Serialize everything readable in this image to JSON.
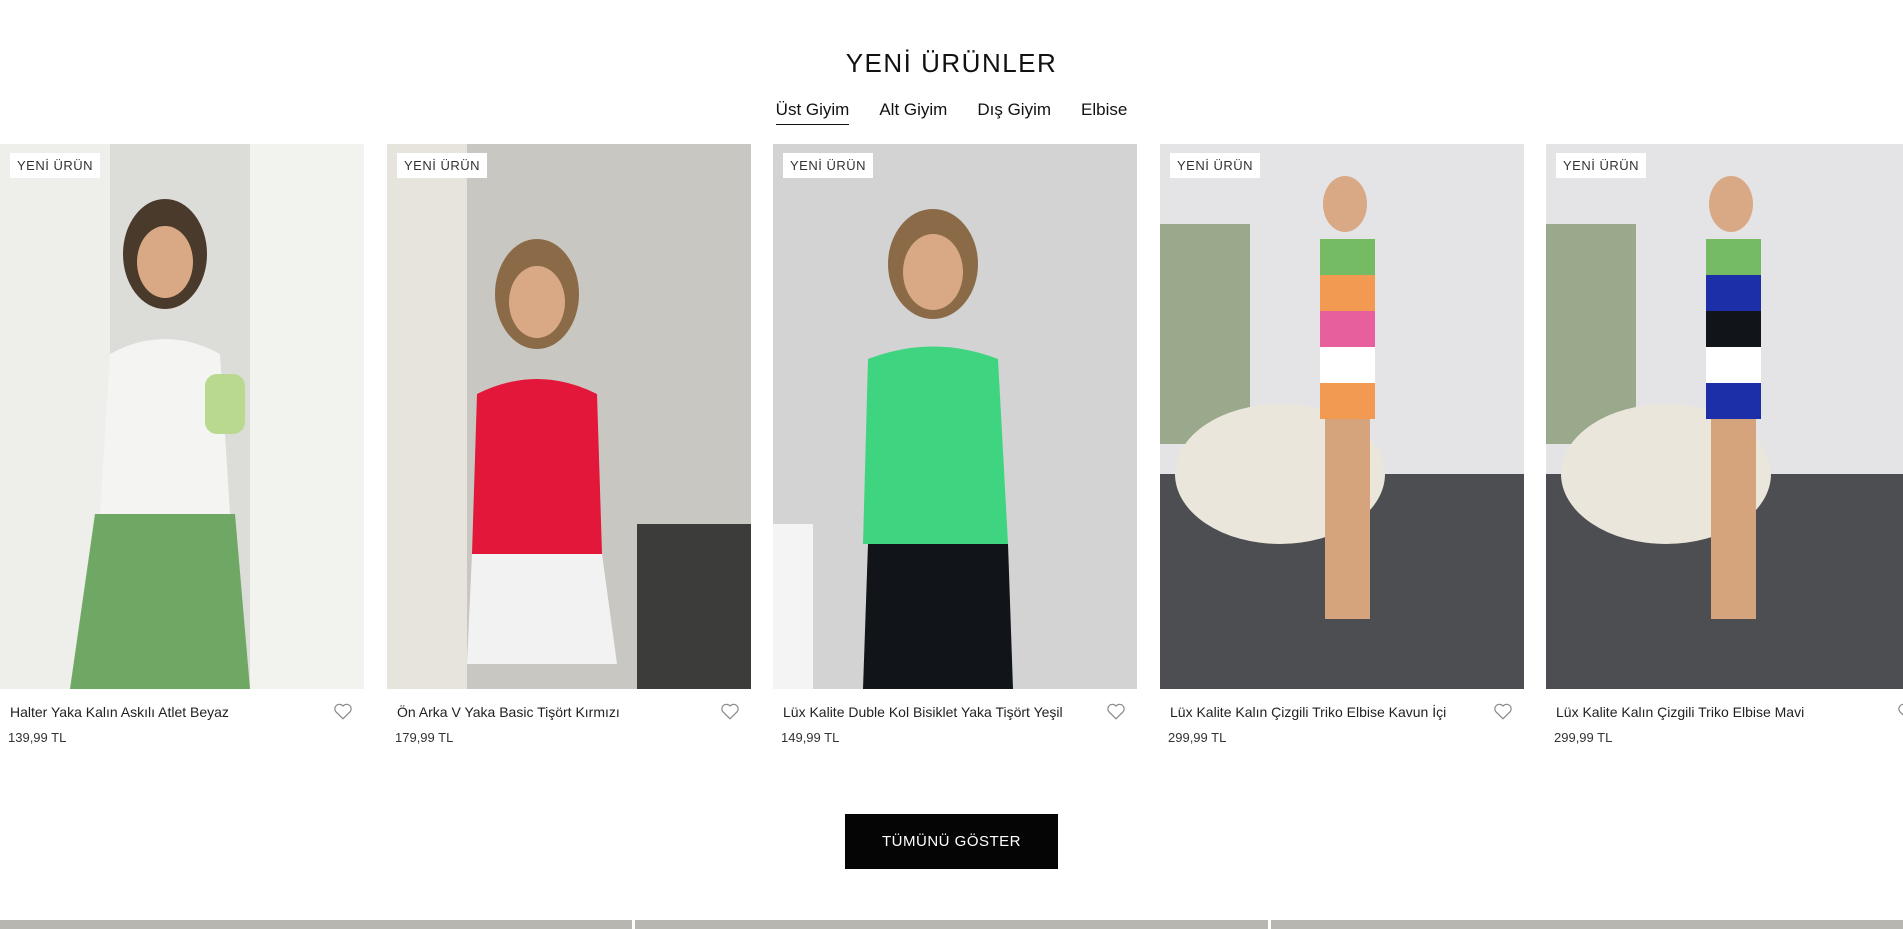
{
  "section": {
    "title": "YENİ ÜRÜNLER",
    "tabs": [
      {
        "label": "Üst Giyim",
        "active": true
      },
      {
        "label": "Alt Giyim",
        "active": false
      },
      {
        "label": "Dış Giyim",
        "active": false
      },
      {
        "label": "Elbise",
        "active": false
      }
    ]
  },
  "products": [
    {
      "badge": "YENİ ÜRÜN",
      "name": "Halter Yaka Kalın Askılı Atlet Beyaz",
      "price": "139,99 TL",
      "top_color": "#f4f4f2",
      "bottom_color": "#6fa864",
      "bg_color": "#dcdcd8"
    },
    {
      "badge": "YENİ ÜRÜN",
      "name": "Ön Arka V Yaka Basic Tişört Kırmızı",
      "price": "179,99 TL",
      "top_color": "#e2173a",
      "bottom_color": "#f2f2f2",
      "bg_color": "#c9c7c1"
    },
    {
      "badge": "YENİ ÜRÜN",
      "name": "Lüx Kalite Duble Kol Bisiklet Yaka Tişört Yeşil",
      "price": "149,99 TL",
      "top_color": "#3fd47f",
      "bottom_color": "#111418",
      "bg_color": "#d3d3d3"
    },
    {
      "badge": "YENİ ÜRÜN",
      "name": "Lüx Kalite Kalın Çizgili Triko Elbise Kavun İçi",
      "price": "299,99 TL",
      "top_color": "#f39a52",
      "bottom_color": "#e85f9e",
      "bg_color": "#e4e4e6"
    },
    {
      "badge": "YENİ ÜRÜN",
      "name": "Lüx Kalite Kalın Çizgili Triko Elbise Mavi",
      "price": "299,99 TL",
      "top_color": "#1d2fa8",
      "bottom_color": "#75bb63",
      "bg_color": "#e4e4e6"
    }
  ],
  "cta": {
    "label": "TÜMÜNÜ GÖSTER"
  },
  "icons": {
    "favorite": "heart-icon"
  }
}
